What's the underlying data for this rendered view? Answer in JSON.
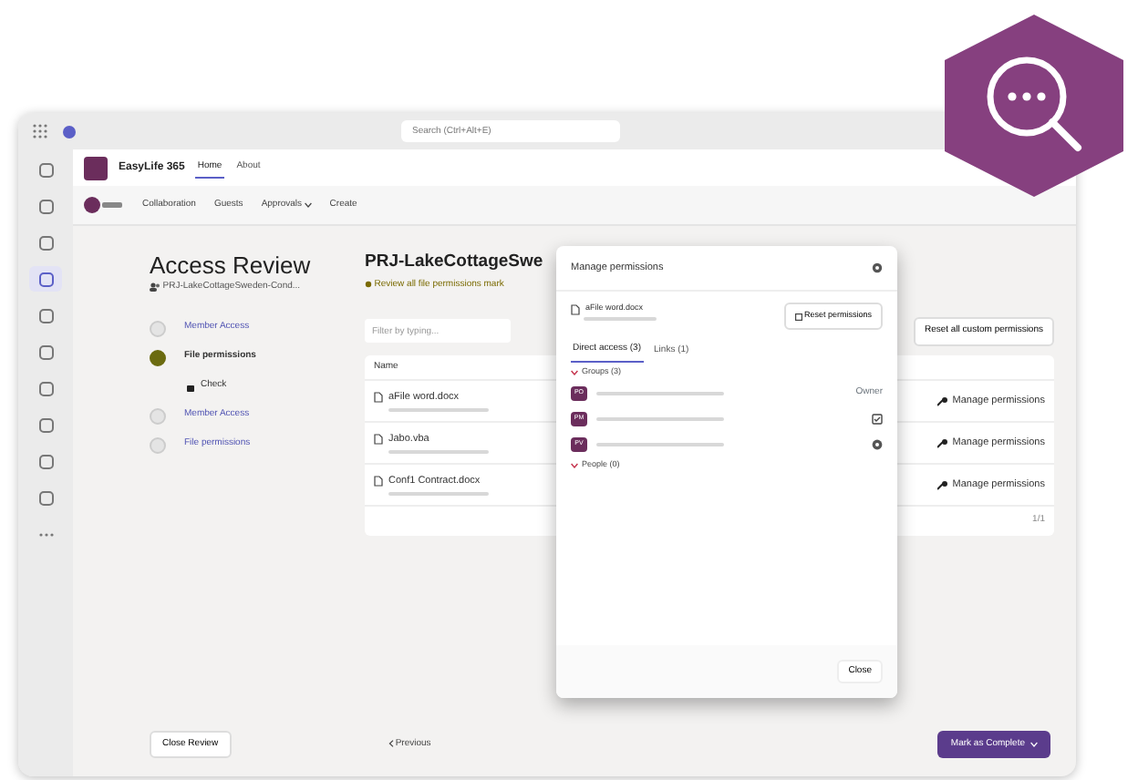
{
  "search": {
    "placeholder": "Search (Ctrl+Alt+E)"
  },
  "rail": [
    {
      "selected": false
    },
    {
      "selected": false
    },
    {
      "selected": false
    },
    {
      "selected": true
    },
    {
      "selected": false
    },
    {
      "selected": false
    },
    {
      "selected": false
    },
    {
      "selected": false
    },
    {
      "selected": false
    },
    {
      "selected": false
    },
    {
      "selected": false
    }
  ],
  "app": {
    "name": "EasyLife 365",
    "tabs": [
      {
        "label": "Home",
        "selected": true
      },
      {
        "label": "About",
        "selected": false
      }
    ]
  },
  "nav": [
    {
      "label": "Collaboration",
      "dropdown": false
    },
    {
      "label": "Guests",
      "dropdown": false
    },
    {
      "label": "Approvals",
      "dropdown": true
    },
    {
      "label": "Create",
      "dropdown": false
    }
  ],
  "review": {
    "title": "Access Review",
    "subtitle": "PRJ-LakeCottageSweden-Cond..."
  },
  "steps": [
    {
      "kind": "step",
      "label": "Member Access",
      "selected": false
    },
    {
      "kind": "step",
      "label": "File permissions",
      "selected": true
    },
    {
      "kind": "group",
      "label": "Check"
    },
    {
      "kind": "step",
      "label": "Member Access",
      "selected": false
    },
    {
      "kind": "step",
      "label": "File permissions",
      "selected": false
    }
  ],
  "main": {
    "title": "PRJ-LakeCottageSwe",
    "notice": "Review all file permissions mark",
    "filter": {
      "placeholder": "Filter by typing..."
    },
    "reset_all": "Reset all custom permissions",
    "columns": [
      "Name"
    ],
    "files": [
      {
        "name": "aFile word.docx",
        "action": "Manage permissions"
      },
      {
        "name": "Jabo.vba",
        "action": "Manage permissions"
      },
      {
        "name": "Conf1 Contract.docx",
        "action": "Manage permissions"
      }
    ],
    "pager": "1/1"
  },
  "footer": {
    "close": "Close Review",
    "previous": "Previous",
    "complete": "Mark as Complete"
  },
  "modal": {
    "title": "Manage permissions",
    "file": "aFile word.docx",
    "reset": "Reset permissions",
    "tabs": [
      {
        "label": "Direct access (3)",
        "selected": true
      },
      {
        "label": "Links (1)",
        "selected": false
      }
    ],
    "groups": {
      "label": "Groups (3)",
      "expanded": true
    },
    "members": [
      {
        "initials": "PO",
        "kind": "owner",
        "role": "Owner"
      },
      {
        "initials": "PM",
        "kind": "edit"
      },
      {
        "initials": "PV",
        "kind": "view"
      }
    ],
    "people": {
      "label": "People (0)",
      "expanded": true
    },
    "close": "Close"
  }
}
